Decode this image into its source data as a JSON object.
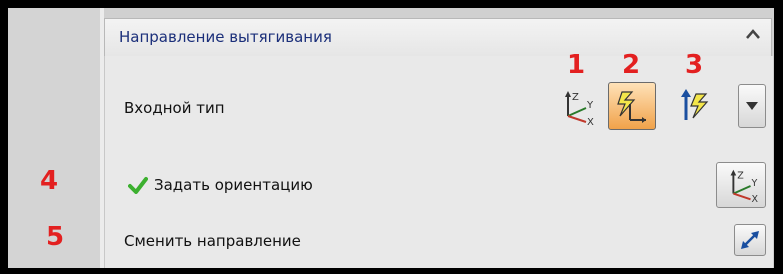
{
  "panel": {
    "title": "Направление вытягивания",
    "collapse_icon": "chevron-up-icon"
  },
  "rows": {
    "input_type_label": "Входной тип",
    "orientation_label": "Задать ориентацию",
    "reverse_label": "Сменить направление"
  },
  "markers": [
    "1",
    "2",
    "3",
    "4",
    "5"
  ],
  "icons": {
    "input_type_1": "axis-triad-icon",
    "input_type_2": "vector-pick-icon",
    "input_type_3": "arrow-vector-icon",
    "dropdown": "dropdown-arrow-icon",
    "orientation": "axis-triad-icon",
    "reverse": "reverse-direction-icon",
    "orientation_status": "checkmark-icon"
  },
  "colors": {
    "marker_red": "#e32020",
    "title_blue": "#1b2f7a",
    "selected_orange": "#f0a24a",
    "check_green": "#3cb02f"
  }
}
